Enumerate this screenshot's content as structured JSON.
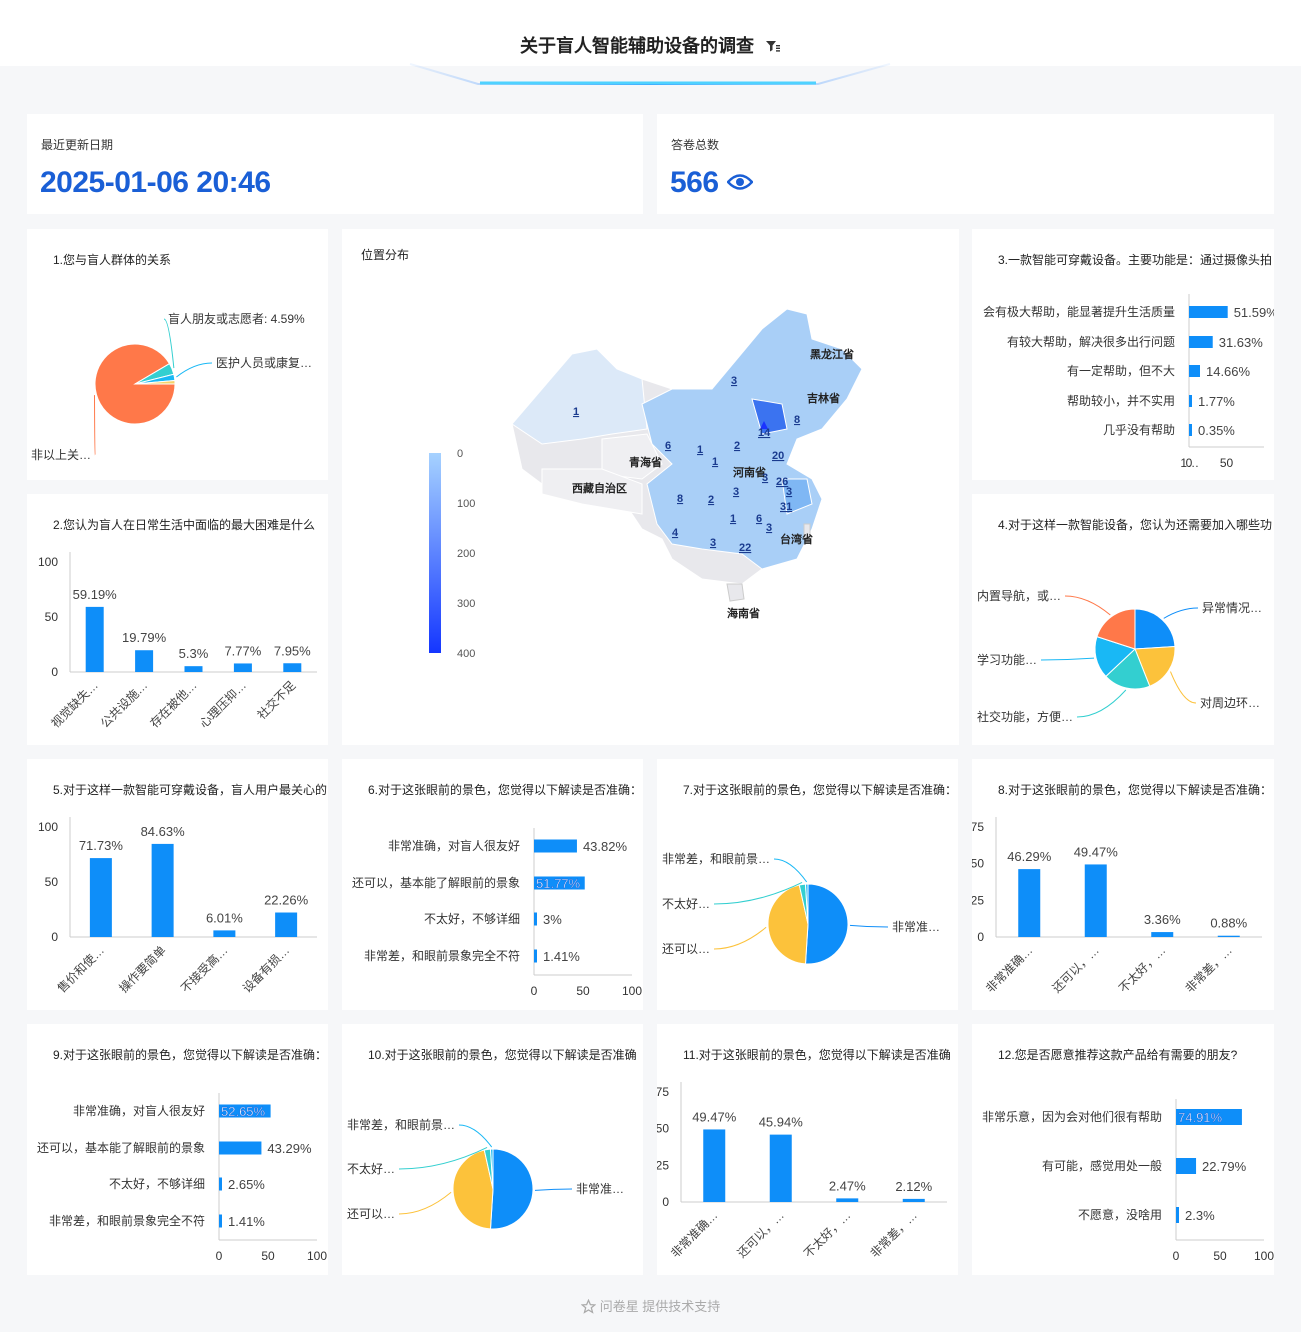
{
  "page": {
    "title": "关于盲人智能辅助设备的调查",
    "footer": "问卷星 提供技术支持"
  },
  "stats": {
    "update_label": "最近更新日期",
    "update_value": "2025-01-06 20:46",
    "total_label": "答卷总数",
    "total_value": "566"
  },
  "colors": {
    "bar": "#0e8ef9",
    "accent": "#1a5fd6",
    "pie": [
      "#0e8ef9",
      "#fcc23b",
      "#33cfd0",
      "#19b8f5",
      "#ff7849",
      "#f5d36b"
    ]
  },
  "map": {
    "title": "位置分布",
    "legend_ticks": [
      "0",
      "100",
      "200",
      "300",
      "400"
    ],
    "provinces": [
      "黑龙江省",
      "吉林省",
      "青海省",
      "河南省",
      "西藏自治区",
      "台湾省",
      "海南省"
    ],
    "values": [
      "3",
      "1",
      "6",
      "1",
      "2",
      "14",
      "8",
      "1",
      "20",
      "3",
      "3",
      "26",
      "8",
      "2",
      "31",
      "3",
      "1",
      "6",
      "4",
      "3",
      "3",
      "22"
    ]
  },
  "chart_data": [
    {
      "id": "q1",
      "type": "pie",
      "title": "1.您与盲人群体的关系",
      "labels": [
        "非以上关…",
        "盲人朋友或志愿者: 4.59%",
        "医护人员或康复…",
        ""
      ],
      "values": [
        91.5,
        4.59,
        2.5,
        1.41
      ]
    },
    {
      "id": "q2",
      "type": "bar",
      "title": "2.您认为盲人在日常生活中面临的最大困难是什么",
      "categories": [
        "视觉缺失…",
        "公共设施…",
        "存在被他…",
        "心理压抑…",
        "社交不足"
      ],
      "values": [
        59.19,
        19.79,
        5.3,
        7.77,
        7.95
      ],
      "value_labels": [
        "59.19%",
        "19.79%",
        "5.3%",
        "7.77%",
        "7.95%"
      ],
      "yticks": [
        "0",
        "50",
        "100"
      ],
      "ylim": [
        0,
        100
      ]
    },
    {
      "id": "q3",
      "type": "hbar",
      "title": "3.一款智能可穿戴设备。主要功能是：通过摄像头拍",
      "categories": [
        "会有极大帮助，能显著提升生活质量",
        "有较大帮助，解决很多出行问题",
        "有一定帮助，但不大",
        "帮助较小，并不实用",
        "几乎没有帮助"
      ],
      "values": [
        51.59,
        31.63,
        14.66,
        1.77,
        0.35
      ],
      "value_labels": [
        "51.59%",
        "31.63%",
        "14.66%",
        "1.77%",
        "0.35%"
      ],
      "xticks": [
        "0",
        "50",
        "1…"
      ],
      "xlim": [
        0,
        100
      ]
    },
    {
      "id": "q4",
      "type": "pie",
      "title": "4.对于这样一款智能设备，您认为还需要加入哪些功",
      "labels": [
        "异常情况…",
        "对周边环…",
        "社交功能，方便…",
        "学习功能…",
        "内置导航，或…"
      ],
      "values": [
        24,
        20,
        19,
        17,
        20
      ]
    },
    {
      "id": "q5",
      "type": "bar",
      "title": "5.对于这样一款智能可穿戴设备，盲人用户最关心的",
      "categories": [
        "售价和使…",
        "操作要简单",
        "不接受高…",
        "设备有损…"
      ],
      "values": [
        71.73,
        84.63,
        6.01,
        22.26
      ],
      "value_labels": [
        "71.73%",
        "84.63%",
        "6.01%",
        "22.26%"
      ],
      "yticks": [
        "0",
        "50",
        "100"
      ],
      "ylim": [
        0,
        100
      ]
    },
    {
      "id": "q6",
      "type": "hbar",
      "title": "6.对于这张眼前的景色，您觉得以下解读是否准确：",
      "categories": [
        "非常准确，对盲人很友好",
        "还可以，基本能了解眼前的景象",
        "不太好，不够详细",
        "非常差，和眼前景象完全不符"
      ],
      "values": [
        43.82,
        51.77,
        3,
        1.41
      ],
      "value_labels": [
        "43.82%",
        "51.77%",
        "3%",
        "1.41%"
      ],
      "xticks": [
        "0",
        "50",
        "100"
      ],
      "xlim": [
        0,
        100
      ]
    },
    {
      "id": "q7",
      "type": "pie",
      "title": "7.对于这张眼前的景色，您觉得以下解读是否准确：",
      "labels": [
        "非常准…",
        "还可以…",
        "不太好…",
        "非常差，和眼前景…"
      ],
      "values": [
        51,
        45.5,
        2.5,
        1
      ]
    },
    {
      "id": "q8",
      "type": "bar",
      "title": "8.对于这张眼前的景色，您觉得以下解读是否准确：",
      "categories": [
        "非常准确…",
        "还可以，…",
        "不太好，…",
        "非常差，…"
      ],
      "values": [
        46.29,
        49.47,
        3.36,
        0.88
      ],
      "value_labels": [
        "46.29%",
        "49.47%",
        "3.36%",
        "0.88%"
      ],
      "yticks": [
        "0",
        "25",
        "50",
        "75"
      ],
      "ylim": [
        0,
        75
      ]
    },
    {
      "id": "q9",
      "type": "hbar",
      "title": "9.对于这张眼前的景色，您觉得以下解读是否准确：",
      "categories": [
        "非常准确，对盲人很友好",
        "还可以，基本能了解眼前的景象",
        "不太好，不够详细",
        "非常差，和眼前景象完全不符"
      ],
      "values": [
        52.65,
        43.29,
        2.65,
        1.41
      ],
      "value_labels": [
        "52.65%",
        "43.29%",
        "2.65%",
        "1.41%"
      ],
      "xticks": [
        "0",
        "50",
        "100"
      ],
      "xlim": [
        0,
        100
      ]
    },
    {
      "id": "q10",
      "type": "pie",
      "title": "10.对于这张眼前的景色，您觉得以下解读是否准确",
      "labels": [
        "非常准…",
        "还可以…",
        "不太好…",
        "非常差，和眼前景…"
      ],
      "values": [
        51,
        45.5,
        2.5,
        1
      ]
    },
    {
      "id": "q11",
      "type": "bar",
      "title": "11.对于这张眼前的景色，您觉得以下解读是否准确",
      "categories": [
        "非常准确…",
        "还可以，…",
        "不太好，…",
        "非常差，…"
      ],
      "values": [
        49.47,
        45.94,
        2.47,
        2.12
      ],
      "value_labels": [
        "49.47%",
        "45.94%",
        "2.47%",
        "2.12%"
      ],
      "yticks": [
        "0",
        "25",
        "50",
        "75"
      ],
      "ylim": [
        0,
        75
      ]
    },
    {
      "id": "q12",
      "type": "hbar",
      "title": "12.您是否愿意推荐这款产品给有需要的朋友?",
      "categories": [
        "非常乐意，因为会对他们很有帮助",
        "有可能，感觉用处一般",
        "不愿意，没啥用"
      ],
      "values": [
        74.91,
        22.79,
        2.3
      ],
      "value_labels": [
        "74.91%",
        "22.79%",
        "2.3%"
      ],
      "xticks": [
        "0",
        "50",
        "100"
      ],
      "xlim": [
        0,
        100
      ]
    }
  ]
}
